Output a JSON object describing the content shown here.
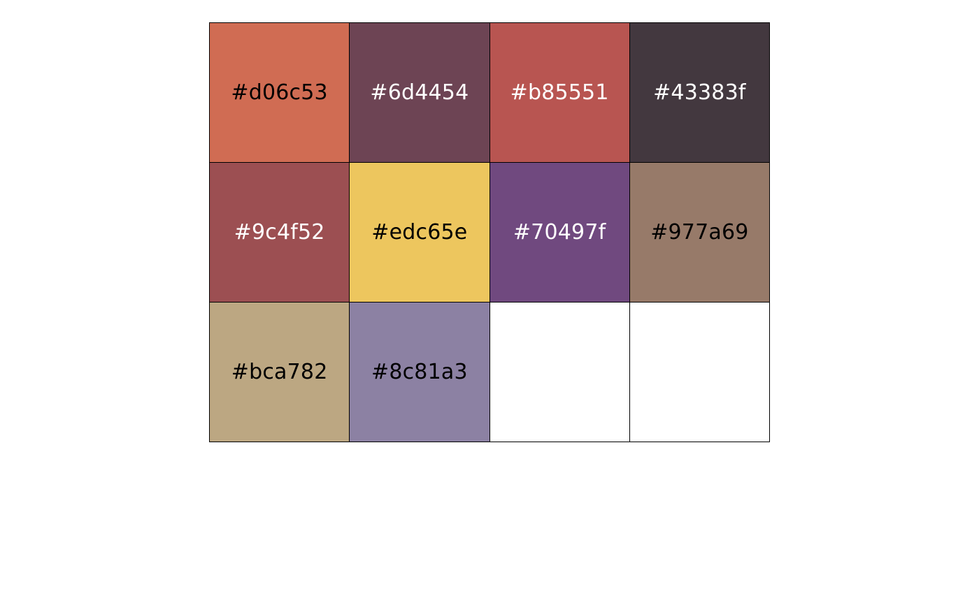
{
  "swatches": [
    {
      "hex": "#d06c53",
      "label": "#d06c53",
      "text_color": "#000000"
    },
    {
      "hex": "#6d4454",
      "label": "#6d4454",
      "text_color": "#ffffff"
    },
    {
      "hex": "#b85551",
      "label": "#b85551",
      "text_color": "#ffffff"
    },
    {
      "hex": "#43383f",
      "label": "#43383f",
      "text_color": "#ffffff"
    },
    {
      "hex": "#9c4f52",
      "label": "#9c4f52",
      "text_color": "#ffffff"
    },
    {
      "hex": "#edc65e",
      "label": "#edc65e",
      "text_color": "#000000"
    },
    {
      "hex": "#70497f",
      "label": "#70497f",
      "text_color": "#ffffff"
    },
    {
      "hex": "#977a69",
      "label": "#977a69",
      "text_color": "#000000"
    },
    {
      "hex": "#bca782",
      "label": "#bca782",
      "text_color": "#000000"
    },
    {
      "hex": "#8c81a3",
      "label": "#8c81a3",
      "text_color": "#000000"
    },
    {
      "hex": "#ffffff",
      "label": "",
      "text_color": "#000000"
    },
    {
      "hex": "#ffffff",
      "label": "",
      "text_color": "#000000"
    }
  ]
}
